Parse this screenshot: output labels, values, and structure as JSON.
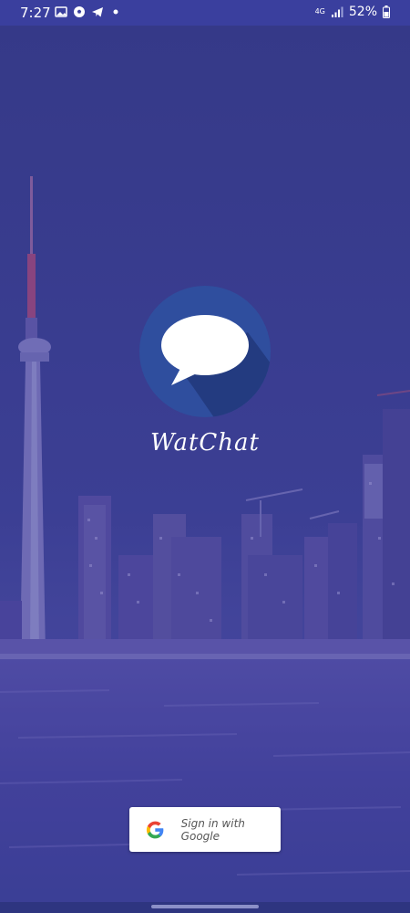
{
  "status_bar": {
    "time": "7:27",
    "left_icons": [
      "image-icon",
      "soccer-ball-icon",
      "telegram-icon",
      "dot-icon"
    ],
    "network": "4G",
    "battery": "52%"
  },
  "app": {
    "name": "WatChat"
  },
  "sign_in": {
    "label": "Sign in with Google"
  },
  "colors": {
    "status_bar": "#3a3f9e",
    "overlay": "#3a3f9e",
    "logo_circle": "#2f4e9e",
    "logo_shadow": "#21387a"
  }
}
